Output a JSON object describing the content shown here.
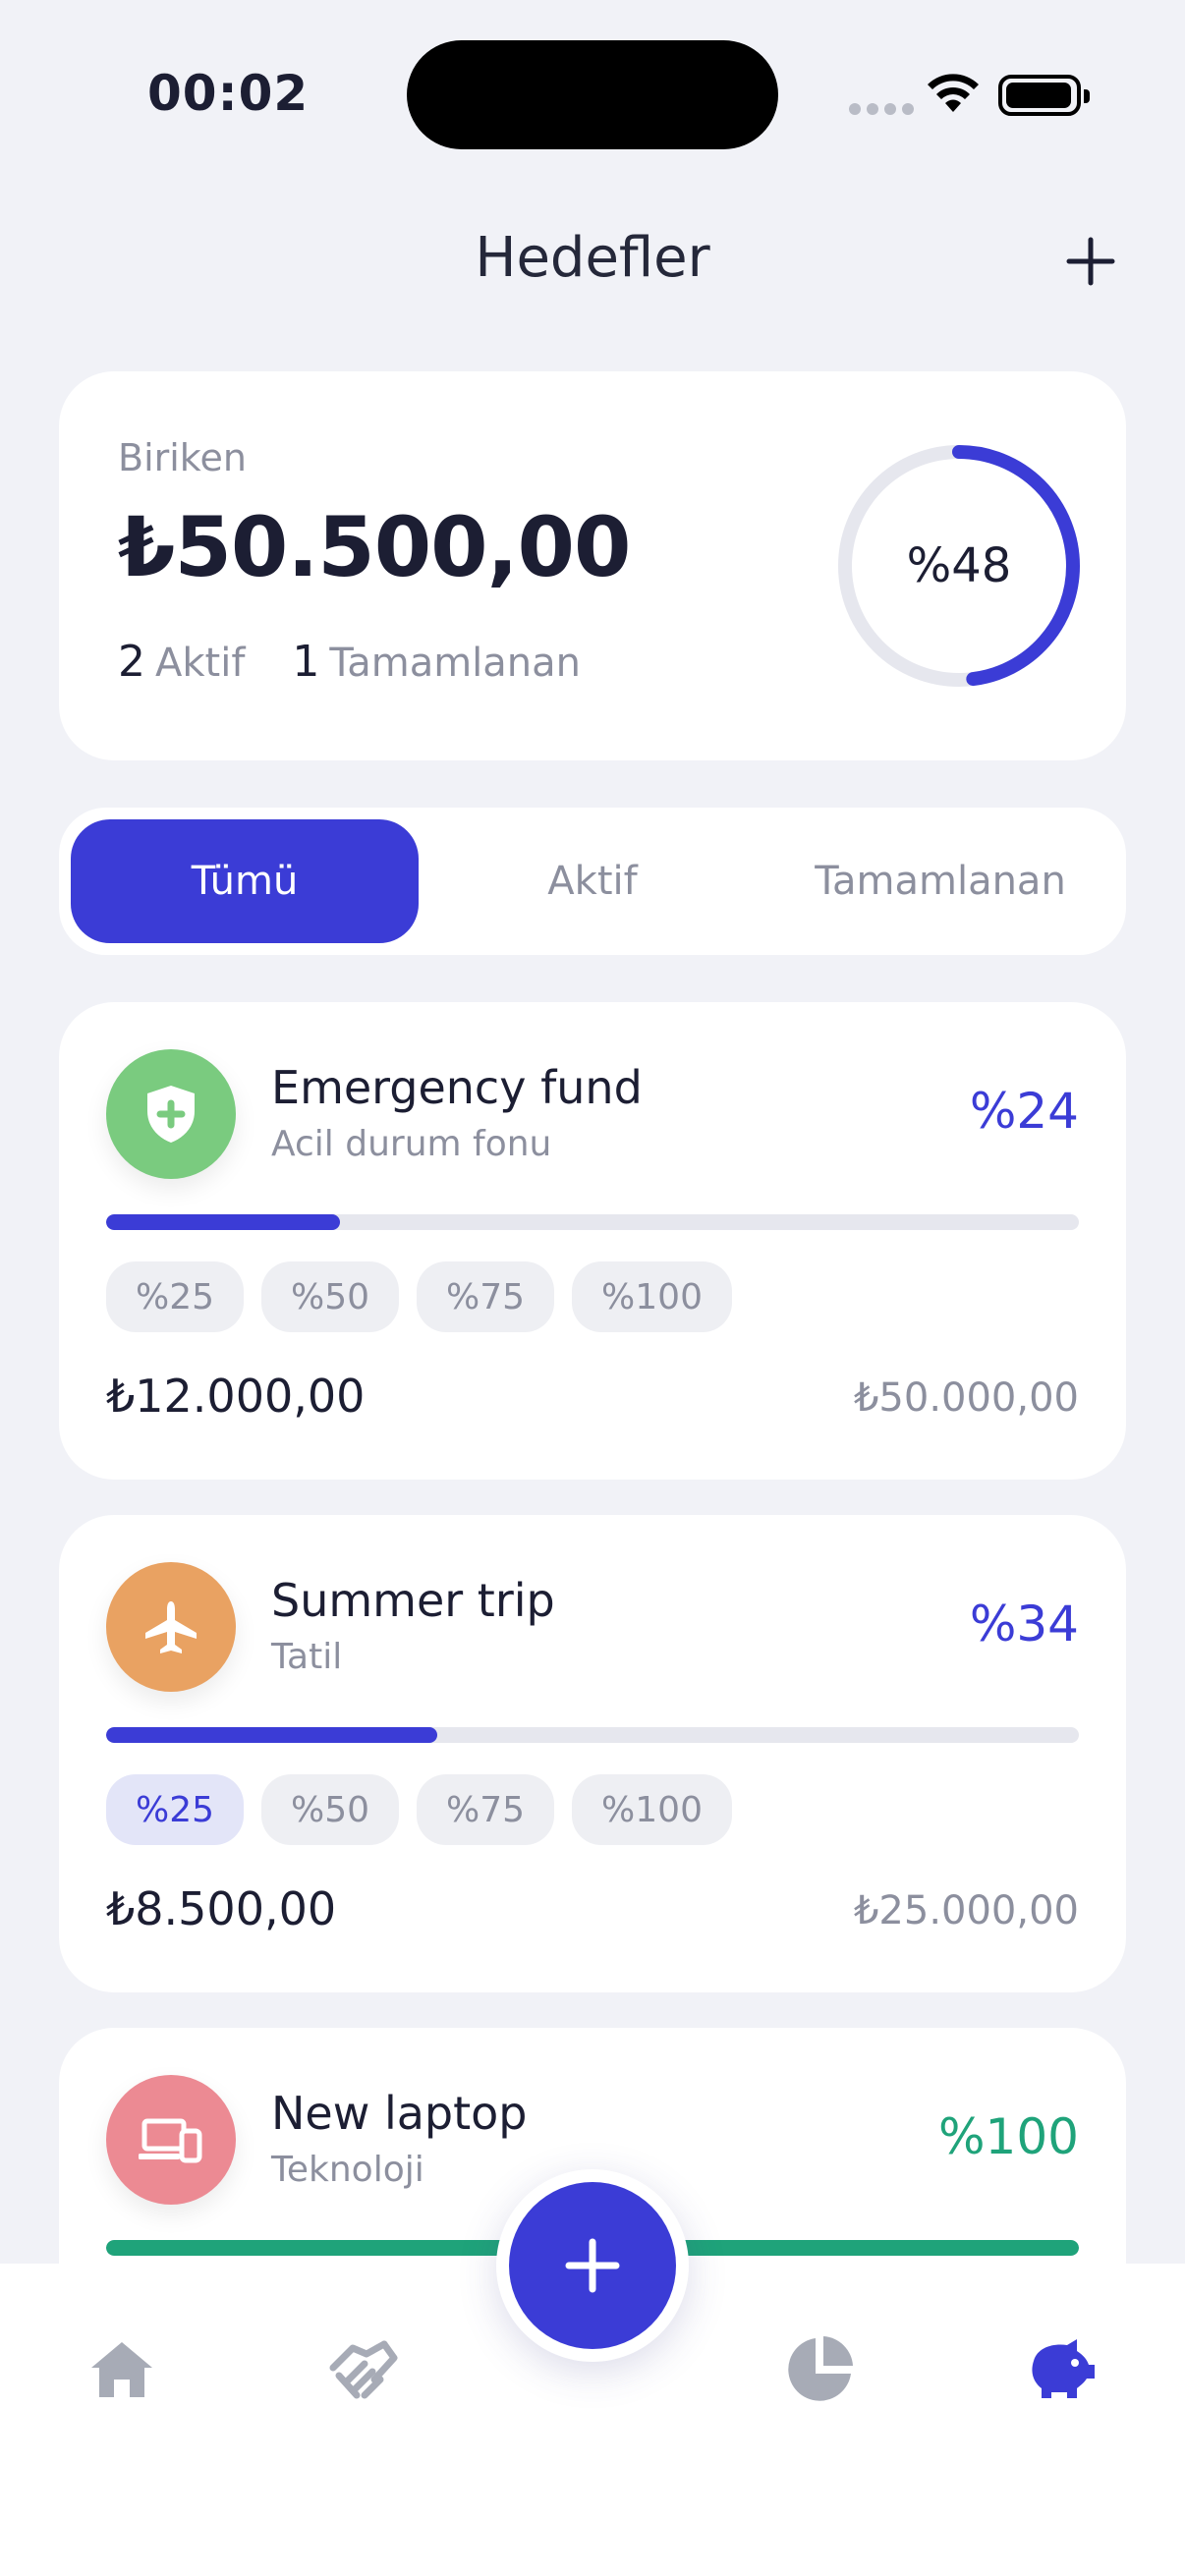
{
  "status_bar": {
    "time": "00:02"
  },
  "header": {
    "title": "Hedefler",
    "add_icon": "plus-icon"
  },
  "summary": {
    "label": "Biriken",
    "amount": "₺50.500,00",
    "active_count": "2",
    "active_label": "Aktif",
    "completed_count": "1",
    "completed_label": "Tamamlanan",
    "progress_text": "%48",
    "progress_fraction": 0.48
  },
  "filter": {
    "tabs": [
      "Tümü",
      "Aktif",
      "Tamamlanan"
    ],
    "selected": "Tümü"
  },
  "goals": [
    {
      "name": "Emergency fund",
      "category": "Acil durum fonu",
      "percent_text": "%24",
      "progress": 0.24,
      "icon": "shield-plus-icon",
      "color": "#7ACB7F",
      "chips": [
        "%25",
        "%50",
        "%75",
        "%100"
      ],
      "current": "₺12.000,00",
      "target": "₺50.000,00"
    },
    {
      "name": "Summer trip",
      "category": "Tatil",
      "percent_text": "%34",
      "progress": 0.34,
      "icon": "airplane-icon",
      "color": "#E9A262",
      "chips": [
        "%25",
        "%50",
        "%75",
        "%100"
      ],
      "current": "₺8.500,00",
      "target": "₺25.000,00"
    },
    {
      "name": "New laptop",
      "category": "Teknoloji",
      "percent_text": "%100",
      "progress": 1.0,
      "icon": "devices-icon",
      "color": "#EC8A93"
    }
  ],
  "tabbar": {
    "items": [
      "home-icon",
      "handshake-icon",
      "add-fab-icon",
      "pie-chart-icon",
      "piggy-bank-icon"
    ],
    "active": "piggy-bank-icon",
    "accent": "#3B3CD6",
    "inactive": "#A7ABB6"
  }
}
